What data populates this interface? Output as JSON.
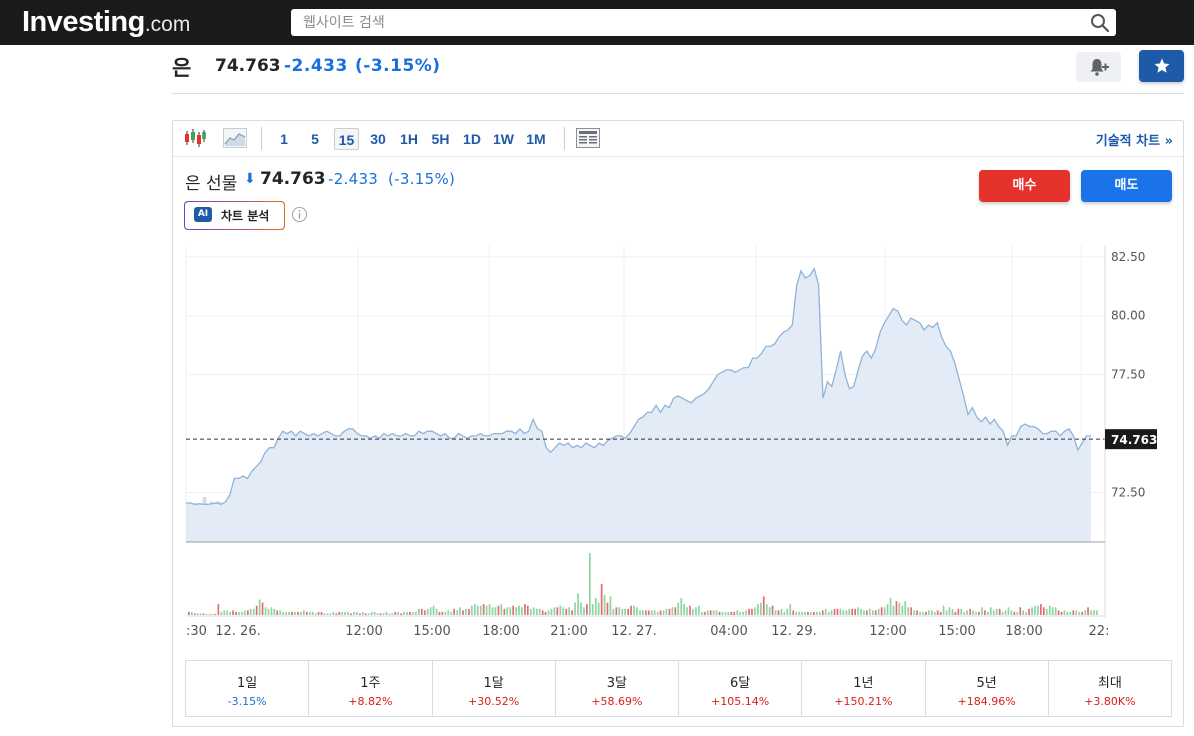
{
  "header": {
    "logo_main": "Investing",
    "logo_suffix": ".com",
    "search_placeholder": "웹사이트 검색"
  },
  "title": {
    "name": "은",
    "price": "74.763",
    "change": "-2.433",
    "change_pct": "(-3.15%)"
  },
  "toolbar": {
    "timeframes": [
      "1",
      "5",
      "15",
      "30",
      "1H",
      "5H",
      "1D",
      "1W",
      "1M"
    ],
    "active_timeframe": "15",
    "tech_chart_label": "기술적 차트 »"
  },
  "instrument": {
    "name": "은 선물",
    "arrow": "⬇",
    "price": "74.763",
    "change": "-2.433",
    "change_pct": "(-3.15%)",
    "ai_badge": "AI",
    "ai_label": "차트 분석",
    "buy_label": "매수",
    "sell_label": "매도"
  },
  "chart_data": {
    "type": "area",
    "y_ticks": [
      "82.50",
      "80.00",
      "77.50",
      "72.50"
    ],
    "current_price_label": "74.763",
    "watermark": "Investing.com",
    "x_tick_labels": [
      ":30",
      "12. 26.",
      "12:00",
      "15:00",
      "18:00",
      "21:00",
      "12. 27.",
      "04:00",
      "12. 29.",
      "12:00",
      "15:00",
      "18:00",
      "22:"
    ],
    "ylim": [
      70.4,
      83.0
    ],
    "current_value": 74.763,
    "price_values": [
      72.05,
      72.06,
      72.0,
      72.02,
      72.0,
      72.0,
      72.03,
      72.05,
      72.0,
      72.1,
      72.4,
      73.1,
      73.1,
      73.2,
      73.1,
      73.4,
      73.6,
      73.8,
      74.2,
      74.4,
      74.4,
      74.8,
      75.1,
      75.0,
      75.1,
      74.9,
      75.1,
      75.0,
      74.9,
      75.0,
      74.9,
      75.0,
      75.1,
      75.0,
      74.9,
      74.9,
      75.1,
      75.2,
      75.2,
      75.0,
      74.9,
      74.9,
      74.8,
      74.9,
      74.8,
      75.0,
      74.9,
      75.0,
      74.9,
      74.9,
      75.0,
      74.9,
      74.9,
      75.1,
      75.0,
      75.1,
      75.1,
      75.0,
      74.9,
      75.0,
      74.8,
      74.8,
      75.0,
      74.9,
      74.8,
      74.9,
      74.9,
      75.0,
      74.9,
      74.9,
      75.0,
      75.0,
      75.0,
      75.1,
      75.1,
      75.0,
      75.2,
      75.0,
      75.1,
      75.6,
      75.2,
      75.1,
      74.4,
      74.2,
      74.4,
      74.6,
      74.5,
      74.6,
      74.4,
      74.5,
      74.4,
      74.6,
      74.5,
      74.4,
      74.6,
      74.5,
      74.7,
      74.8,
      74.9,
      74.9,
      74.8,
      75.0,
      75.3,
      75.6,
      75.7,
      75.9,
      75.9,
      76.2,
      75.9,
      76.2,
      76.1,
      76.5,
      76.6,
      76.5,
      76.4,
      76.3,
      76.5,
      76.6,
      76.7,
      76.9,
      77.2,
      77.5,
      77.6,
      77.7,
      77.7,
      77.6,
      77.7,
      77.8,
      77.8,
      78.2,
      78.2,
      78.4,
      78.7,
      78.7,
      78.8,
      79.1,
      79.3,
      79.4,
      79.6,
      81.3,
      81.9,
      81.6,
      81.7,
      82.0,
      81.3,
      76.5,
      77.2,
      77.0,
      77.7,
      78.5,
      77.5,
      76.9,
      77.0,
      77.7,
      78.3,
      78.5,
      78.2,
      78.6,
      79.3,
      79.7,
      80.0,
      80.3,
      80.2,
      79.8,
      79.6,
      79.9,
      79.8,
      79.7,
      79.4,
      79.6,
      79.5,
      79.7,
      79.1,
      78.7,
      78.5,
      78.0,
      77.3,
      76.6,
      75.8,
      76.1,
      75.7,
      75.5,
      75.7,
      75.4,
      75.6,
      75.3,
      75.1,
      74.5,
      74.9,
      74.9,
      75.3,
      75.4,
      75.3,
      75.3,
      75.2,
      75.0,
      75.0,
      75.1,
      75.1,
      74.9,
      75.1,
      75.2,
      74.9,
      74.3,
      74.6,
      74.9,
      74.9
    ],
    "volume_values": [
      2,
      2,
      1,
      1,
      1,
      1,
      0,
      0,
      0,
      0,
      7,
      2,
      3,
      3,
      2,
      3,
      2,
      2,
      2,
      3,
      3,
      4,
      4,
      6,
      10,
      8,
      5,
      4,
      5,
      4,
      3,
      3,
      2,
      2,
      2,
      2,
      2,
      2,
      2,
      3,
      2,
      2,
      2,
      1,
      2,
      2,
      1,
      1,
      1,
      2,
      1,
      2,
      2,
      2,
      2,
      1,
      2,
      2,
      1,
      2,
      1,
      1,
      2,
      2,
      1,
      1,
      1,
      2,
      1,
      1,
      2,
      2,
      1,
      2,
      2,
      2,
      2,
      2,
      4,
      4,
      3,
      4,
      5,
      6,
      4,
      2,
      2,
      2,
      3,
      2,
      4,
      3,
      5,
      3,
      4,
      4,
      6,
      7,
      6,
      6,
      7,
      6,
      7,
      5,
      5,
      6,
      7,
      4,
      5,
      5,
      6,
      5,
      6,
      5,
      7,
      6,
      4,
      5,
      4,
      4,
      3,
      2,
      3,
      4,
      5,
      5,
      6,
      5,
      4,
      5,
      3,
      8,
      14,
      8,
      5,
      7,
      40,
      7,
      11,
      8,
      20,
      13,
      8,
      12,
      4,
      5,
      5,
      4,
      4,
      4,
      6,
      6,
      5,
      3,
      3,
      3,
      3,
      3,
      3,
      2,
      3,
      3,
      4,
      4,
      5,
      5,
      8,
      11,
      7,
      5,
      6,
      4,
      5,
      6,
      2,
      2,
      3,
      3,
      3,
      3,
      2,
      2,
      2,
      2,
      2,
      2,
      3,
      2,
      2,
      3,
      4,
      4,
      5,
      7,
      8,
      12,
      7,
      5,
      6,
      3,
      3,
      4,
      2,
      4,
      7,
      3,
      2,
      2,
      2,
      2,
      2,
      2,
      2,
      2,
      2,
      3,
      4,
      2,
      3,
      4,
      4,
      4,
      3,
      3,
      4,
      4,
      4,
      5,
      4,
      3,
      3,
      4,
      3,
      3,
      4,
      5,
      5,
      7,
      11,
      6,
      9,
      8,
      6,
      9,
      5,
      5,
      3,
      3,
      2,
      2,
      2,
      3,
      3,
      2,
      3,
      2,
      6,
      3,
      5,
      4,
      2,
      4,
      4,
      2,
      3,
      4,
      3,
      2,
      2,
      5,
      3,
      2,
      5,
      3,
      4,
      4,
      2,
      3,
      5,
      3,
      2,
      2,
      5,
      3,
      2,
      4,
      5,
      6,
      6,
      7,
      5,
      4,
      6,
      5,
      5,
      3,
      2,
      3,
      2,
      2,
      3,
      3,
      2,
      2,
      3,
      5,
      3,
      3,
      3
    ]
  },
  "periods": [
    {
      "label": "1일",
      "value": "-3.15%",
      "dir": "neg"
    },
    {
      "label": "1주",
      "value": "+8.82%",
      "dir": "pos"
    },
    {
      "label": "1달",
      "value": "+30.52%",
      "dir": "pos"
    },
    {
      "label": "3달",
      "value": "+58.69%",
      "dir": "pos"
    },
    {
      "label": "6달",
      "value": "+105.14%",
      "dir": "pos"
    },
    {
      "label": "1년",
      "value": "+150.21%",
      "dir": "pos"
    },
    {
      "label": "5년",
      "value": "+184.96%",
      "dir": "pos"
    },
    {
      "label": "최대",
      "value": "+3.80K%",
      "dir": "pos"
    }
  ],
  "colors": {
    "accent": "#1e5aa8",
    "negative": "#1b6fdc",
    "positive": "#d91e18",
    "buy": "#e5322d",
    "sell": "#1a73e8",
    "area_fill": "#e3ecf6",
    "area_line": "#8fb3d9",
    "volume_up": "#8fd3a5",
    "volume_down": "#e66b6b"
  }
}
